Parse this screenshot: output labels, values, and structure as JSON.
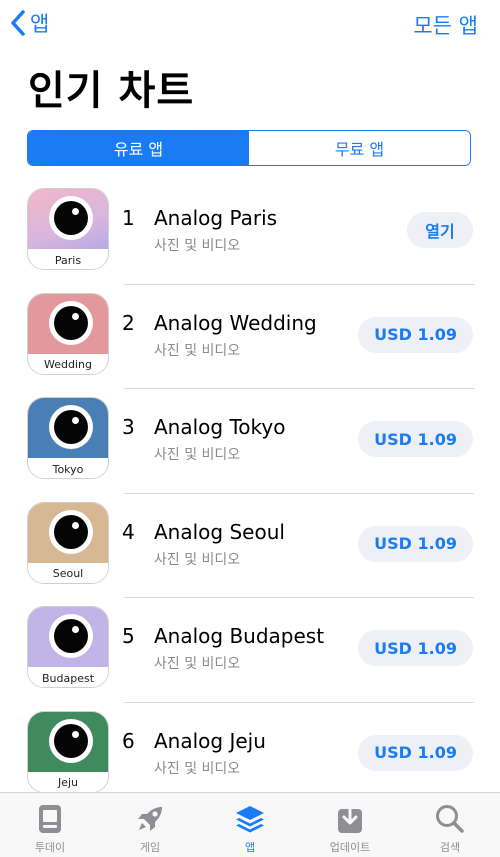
{
  "nav": {
    "back_label": "앱",
    "all_apps_label": "모든 앱"
  },
  "page_title": "인기 차트",
  "segments": [
    {
      "label": "유료 앱",
      "active": true
    },
    {
      "label": "무료 앱",
      "active": false
    }
  ],
  "apps": [
    {
      "rank": "1",
      "name": "Analog Paris",
      "category": "사진 및 비디오",
      "button": "열기",
      "icon_label": "Paris",
      "icon_color": "#e7b8cb"
    },
    {
      "rank": "2",
      "name": "Analog Wedding",
      "category": "사진 및 비디오",
      "button": "USD 1.09",
      "icon_label": "Wedding",
      "icon_color": "#e3999c"
    },
    {
      "rank": "3",
      "name": "Analog Tokyo",
      "category": "사진 및 비디오",
      "button": "USD 1.09",
      "icon_label": "Tokyo",
      "icon_color": "#4a7fb5"
    },
    {
      "rank": "4",
      "name": "Analog Seoul",
      "category": "사진 및 비디오",
      "button": "USD 1.09",
      "icon_label": "Seoul",
      "icon_color": "#d6b894"
    },
    {
      "rank": "5",
      "name": "Analog Budapest",
      "category": "사진 및 비디오",
      "button": "USD 1.09",
      "icon_label": "Budapest",
      "icon_color": "#c1b4e6"
    },
    {
      "rank": "6",
      "name": "Analog Jeju",
      "category": "사진 및 비디오",
      "button": "USD 1.09",
      "icon_label": "Jeju",
      "icon_color": "#3f8a5f"
    }
  ],
  "tabs": [
    {
      "label": "투데이",
      "icon": "today-icon"
    },
    {
      "label": "게임",
      "icon": "rocket-icon"
    },
    {
      "label": "앱",
      "icon": "layers-icon",
      "active": true
    },
    {
      "label": "업데이트",
      "icon": "download-tray-icon"
    },
    {
      "label": "검색",
      "icon": "search-icon"
    }
  ],
  "colors": {
    "accent": "#1a7cf5",
    "button_bg": "#eef0f6",
    "secondary_text": "#8a8a8e",
    "tab_inactive": "#8e8e93"
  }
}
